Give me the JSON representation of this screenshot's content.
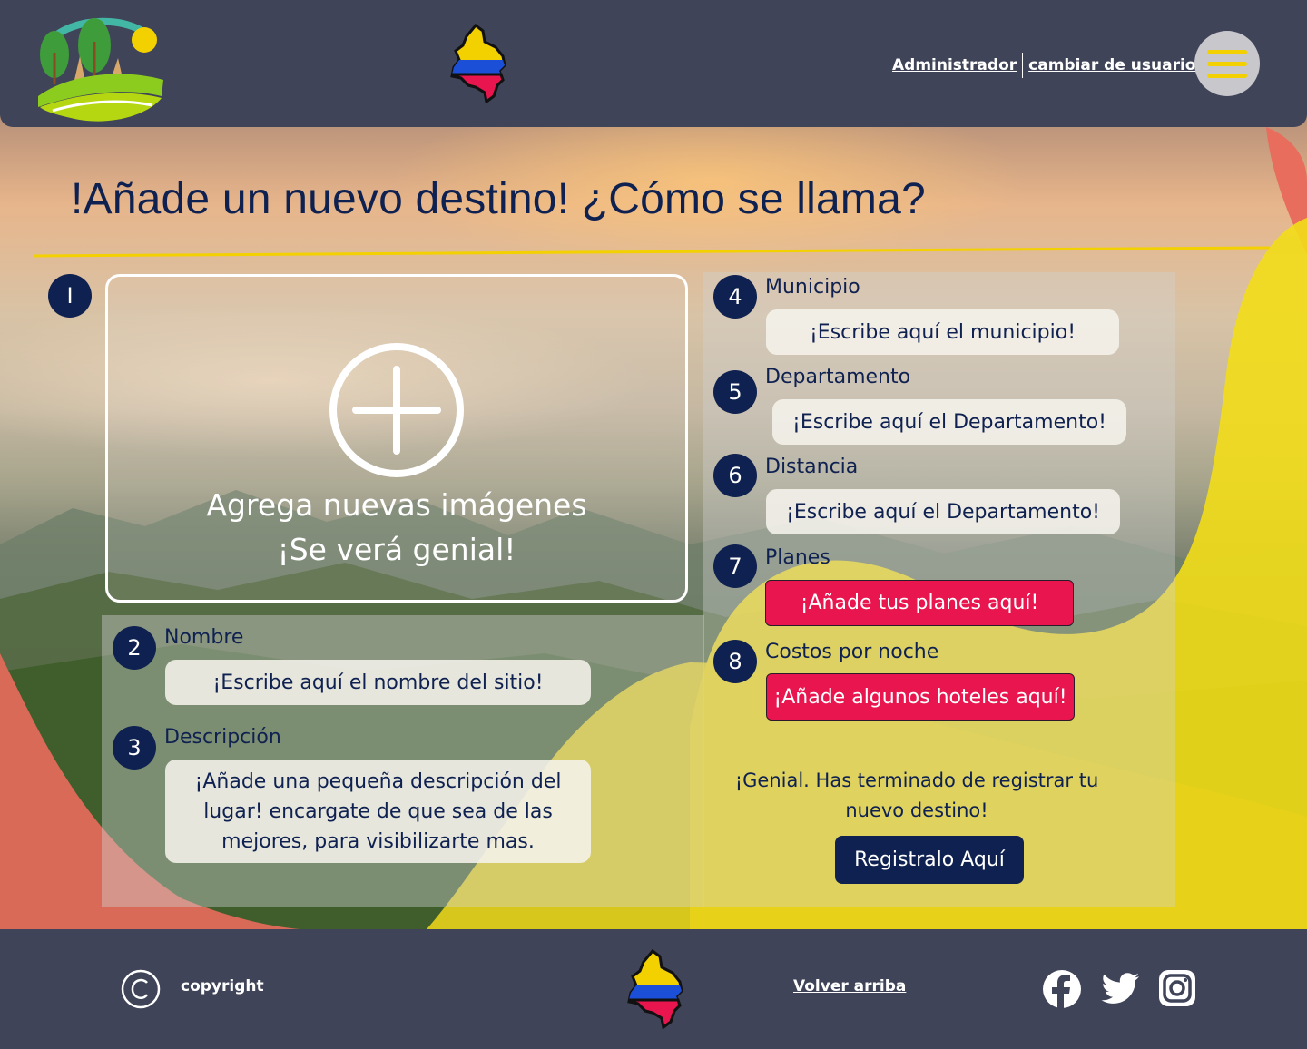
{
  "header": {
    "admin_link": "Administrador",
    "switch_user_link": "cambiar de usuario"
  },
  "main": {
    "title": "!Añade un nuevo destino! ¿Cómo se llama?",
    "upload": {
      "line1": "Agrega nuevas imágenes",
      "line2": "¡Se verá genial!"
    },
    "steps": {
      "s1": "I",
      "s2": "2",
      "s3": "3",
      "s4": "4",
      "s5": "5",
      "s6": "6",
      "s7": "7",
      "s8": "8"
    },
    "nombre": {
      "label": "Nombre",
      "placeholder": "¡Escribe aquí el nombre del sitio!"
    },
    "descripcion": {
      "label": "Descripción",
      "placeholder": "¡Añade una pequeña descripción del lugar! encargate de que sea de las mejores, para visibilizarte mas."
    },
    "municipio": {
      "label": "Municipio",
      "placeholder": "¡Escribe aquí el municipio!"
    },
    "departamento": {
      "label": "Departamento",
      "placeholder": "¡Escribe aquí el Departamento!"
    },
    "distancia": {
      "label": "Distancia",
      "placeholder": "¡Escribe aquí el Departamento!"
    },
    "planes": {
      "label": "Planes",
      "button": "¡Añade tus planes aquí!"
    },
    "costos": {
      "label": "Costos por noche",
      "button": "¡Añade algunos hoteles aquí!"
    },
    "done_message": "¡Genial. Has terminado de registrar tu nuevo destino!",
    "register_button": "Registralo Aquí"
  },
  "footer": {
    "copyright": "copyright",
    "back_to_top": "Volver arriba"
  },
  "colors": {
    "navy": "#0f2150",
    "bar": "#3f4459",
    "accent_yellow": "#f3d000",
    "button_red": "#e8154e"
  },
  "icons": [
    "logo-icon",
    "colombia-map-icon",
    "menu-icon",
    "plus-circle-icon",
    "copyright-icon",
    "facebook-icon",
    "twitter-icon",
    "instagram-icon"
  ]
}
